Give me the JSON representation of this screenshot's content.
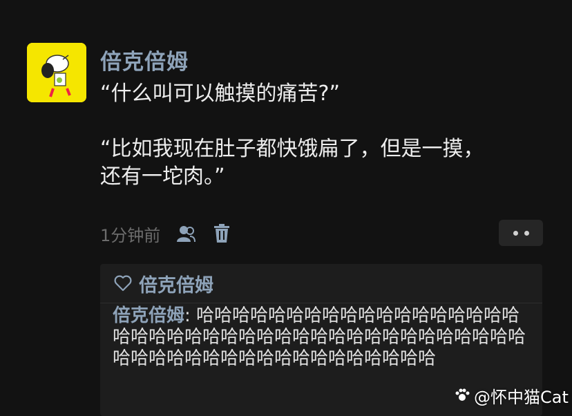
{
  "post": {
    "author": "倍克倍姆",
    "text": "“什么叫可以触摸的痛苦?”\n\n“比如我现在肚子都快饿扁了，但是一摸，\n还有一坨肉。”",
    "time": "1分钟前",
    "icons": {
      "audience": "people-icon",
      "delete": "trash-icon",
      "more": "more-dots-icon"
    }
  },
  "likes": {
    "icon": "heart-icon",
    "names": "倍克倍姆"
  },
  "comment": {
    "author": "倍克倍姆",
    "separator": ": ",
    "text": "哈哈哈哈哈哈哈哈哈哈哈哈哈哈哈哈哈哈哈哈哈哈哈哈哈哈哈哈哈哈哈哈哈哈哈哈哈哈哈哈哈哈哈哈哈哈哈哈哈哈哈哈哈哈哈哈哈哈哈"
  },
  "watermark": {
    "text": "@怀中猫Cat"
  },
  "colors": {
    "background": "#121212",
    "name_link": "#8ea3b9",
    "avatar_bg": "#f5e600",
    "reply_box": "#1d1d1d"
  }
}
